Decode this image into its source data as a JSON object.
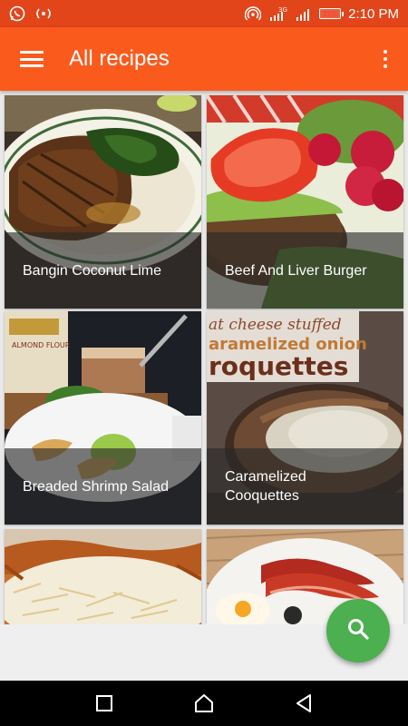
{
  "status_bar": {
    "time": "2:10 PM",
    "battery": "11%",
    "network": "3G",
    "icons": [
      "whatsapp-icon",
      "hotspot-icon",
      "wifi-calling-icon",
      "signal-icon",
      "signal-icon-2",
      "battery-icon"
    ]
  },
  "app_bar": {
    "title": "All recipes",
    "menu_icon": "hamburger-menu-icon",
    "overflow_icon": "overflow-menu-icon"
  },
  "recipes": [
    {
      "name": "Bangin Coconut Lime"
    },
    {
      "name": "Beef And Liver Burger"
    },
    {
      "name": "Breaded Shrimp Salad"
    },
    {
      "name": "Caramelized Cooquettes"
    },
    {
      "name": ""
    },
    {
      "name": ""
    }
  ],
  "images": {
    "croquettes_overlay": [
      "at cheese stuffed",
      "aramelized onion",
      "roquettes"
    ],
    "almond_flour_label": "ALMOND FLOUR"
  },
  "fab": {
    "icon": "search-icon"
  },
  "colors": {
    "status_bar": "#e2451a",
    "app_bar": "#fb5a1d",
    "fab": "#4caf50",
    "nav_bar": "#000000"
  },
  "nav_bar": {
    "buttons": [
      "recents-button",
      "home-button",
      "back-button"
    ]
  }
}
